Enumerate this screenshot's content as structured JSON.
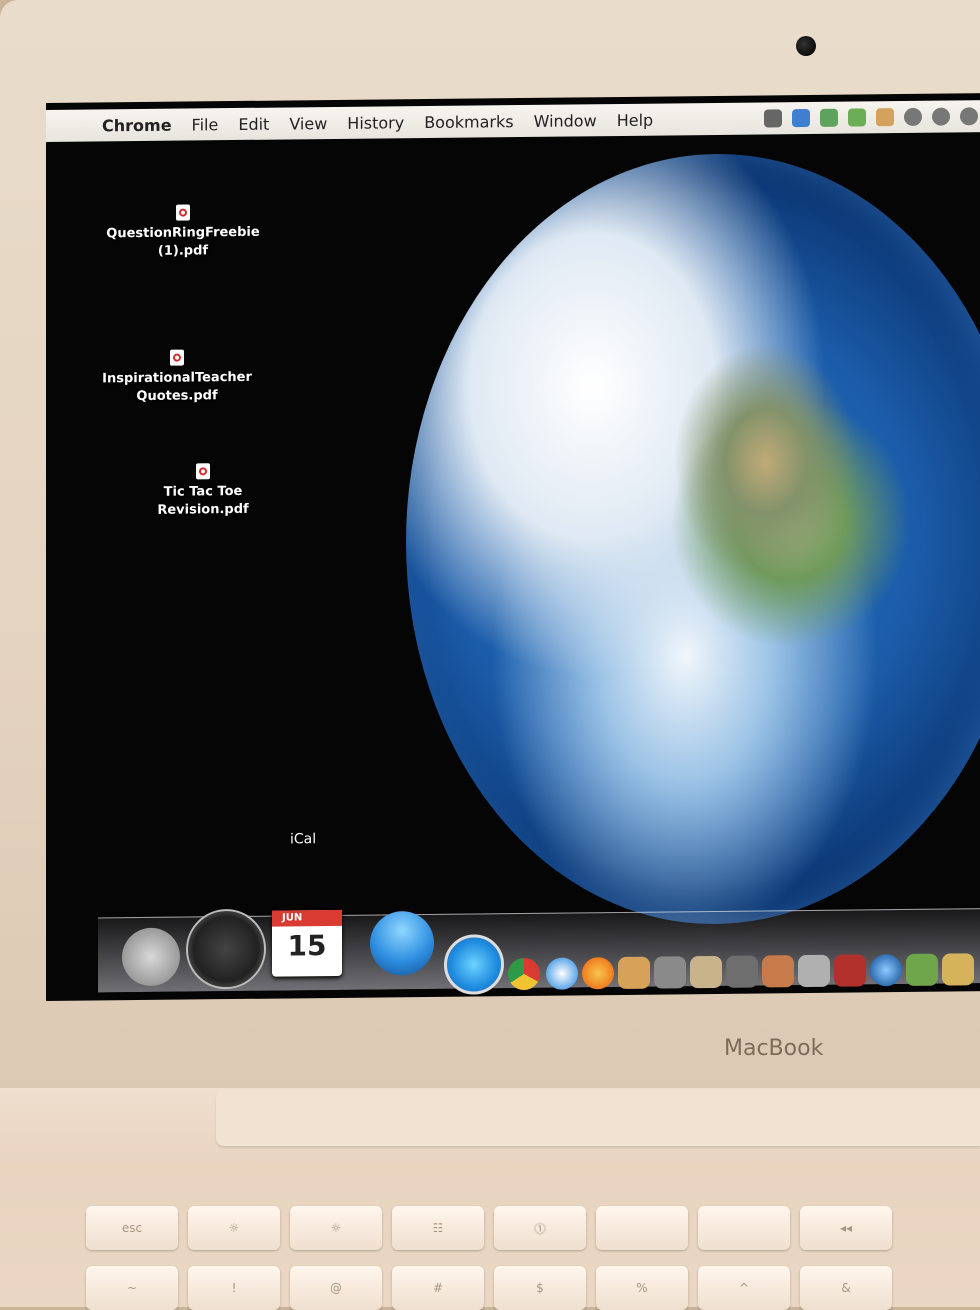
{
  "menubar": {
    "apple_symbol": "",
    "app_name": "Chrome",
    "items": [
      "File",
      "Edit",
      "View",
      "History",
      "Bookmarks",
      "Window",
      "Help"
    ]
  },
  "desktop_icons": [
    {
      "label_line1": "QuestionRingFreebie",
      "label_line2": "(1).pdf"
    },
    {
      "label_line1": "InspirationalTeacher",
      "label_line2": "Quotes.pdf"
    },
    {
      "label_line1": "Tic Tac Toe",
      "label_line2": "Revision.pdf"
    }
  ],
  "dock": {
    "hover_label": "iCal",
    "ical_month": "JUN",
    "ical_day": "15"
  },
  "hardware": {
    "brand_label": "MacBook"
  },
  "keyboard": {
    "top_row": [
      "esc",
      "☼",
      "☼",
      "☷",
      "⓵",
      "",
      "",
      "◂◂",
      "▸‖"
    ],
    "second_row": [
      "~",
      "!",
      "@",
      "#",
      "$",
      "%",
      "^",
      "&",
      "*"
    ]
  }
}
